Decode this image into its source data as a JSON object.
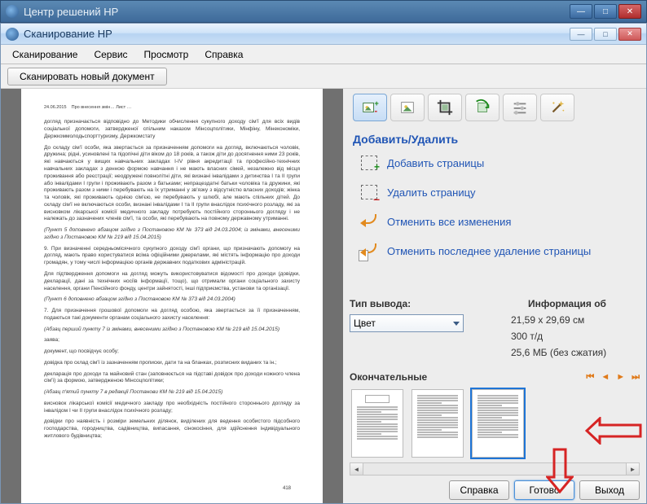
{
  "outer_window": {
    "title": "Центр решений HP"
  },
  "inner_window": {
    "title": "Сканирование HP"
  },
  "menu": {
    "scan": "Сканирование",
    "service": "Сервис",
    "view": "Просмотр",
    "help": "Справка"
  },
  "toolbar": {
    "scan_new": "Сканировать новый документ"
  },
  "section": {
    "add_remove": "Добавить/Удалить"
  },
  "actions": {
    "add_pages": "Добавить страницы",
    "delete_page": "Удалить страницу",
    "undo_all": "Отменить все изменения",
    "undo_last": "Отменить последнее удаление страницы"
  },
  "output": {
    "type_label": "Тип вывода:",
    "type_value": "Цвет",
    "info_label": "Информация об",
    "size": "21,59 x 29,69 см",
    "dpi": "300 т/д",
    "filesize": "25,6 МБ (без сжатия)"
  },
  "final": {
    "label": "Окончательные"
  },
  "buttons": {
    "help": "Справка",
    "done": "Готово",
    "exit": "Выход"
  },
  "preview": {
    "header_date": "24.06.2015",
    "header_meta": "Про внесення змін… Лист …",
    "p1": "догляд призначається відповідно до Методики обчислення сукупного доходу сім'ї для всіх видів соціальної допомоги, затвердженої спільним наказом Мінсоцполітики, Мінфіну, Мінекономіки, Держкоммолодьспорттуризму, Держкомстату",
    "p2": "До складу сім'ї особи, яка звертається за призначенням допомоги на догляд, включаються чоловік, дружина; рідні, усиновлені та підопічні діти віком до 18 років, а також діти до досягнення ними 23 років, які навчаються у вищих навчальних закладах I-IV рівня акредитації та професійно-технічних навчальних закладах з денною формою навчання і не мають власних сімей, незалежно від місця проживання або реєстрації; неодружені повнолітні діти, які визнані інвалідами з дитинства I та II групи або інвалідами I групи і проживають разом з батьками; непрацездатні батьки чоловіка та дружини, які проживають разом з ними і перебувають на їх утриманні у зв'язку з відсутністю власних доходів; жінка та чоловік, які проживають однією сім'єю, не перебувають у шлюбі, але мають спільних дітей. До складу сім'ї не включаються особи, визнані інвалідами I та II групи внаслідок психічного розладу, які за висновком лікарської комісії медичного закладу потребують постійного стороннього догляду і не належать до зазначених членів сім'ї, та особи, які перебувають на повному державному утриманні.",
    "p3it": "(Пункт 5 доповнено абзацом згідно з Постановою КМ № 373 від 24.03.2004; із змінами, внесеними згідно з Постановою КМ № 219 від 15.04.2015)",
    "p4": "9. При визначенні середньомісячного сукупного доходу сім'ї органи, що призначають допомогу на догляд, мають право користуватися всіма офіційними джерелами, які містять інформацію про доходи громадян, у тому числі інформацією органів державних податкових адміністрацій.",
    "p5": "Для підтвердження допомоги на догляд можуть використовуватися відомості про доходи (довідки, декларації, дані за технічних носіїв інформації, тощо), що отримали органи соціального захисту населення, органи Пенсійного фонду, центри зайнятості, інші підприємства, установи та організації.",
    "p6it": "(Пункт 6 доповнено абзацом згідно з Постановою КМ № 373 від 24.03.2004)",
    "p7": "7. Для призначення грошової допомоги на догляд особою, яка звертається за її призначенням, подаються такі документи органам соціального захисту населення:",
    "p8it": "(Абзац перший пункту 7 із змінами, внесеними згідно з Постановою КМ № 219 від 15.04.2015)",
    "p9": "заява;",
    "p10": "документ, що посвідчує особу;",
    "p11": "довідка про склад сім'ї із зазначенням прописки, дати та на бланках, розписних виданих та ін.;",
    "p12": "декларація про доходи та майновий стан (заповнюється на підставі довідок про доходи кожного члена сім'ї) за формою, затвердженою Мінсоцполітики;",
    "p13it": "(Абзац п'ятий пункту 7 в редакції Постанови КМ № 219 від 15.04.2015)",
    "p14": "висновок лікарської комісії медичного закладу про необхідність постійного стороннього догляду за інвалідом I чи II групи внаслідок психічного розладу;",
    "p15": "довідки про наявність і розміри земельних ділянок, виділених для ведення особистого підсобного господарства, городництва, садівництва, випасання, сінокосіння, для здійснення індивідуального житлового будівництва;",
    "pagenum": "418"
  }
}
